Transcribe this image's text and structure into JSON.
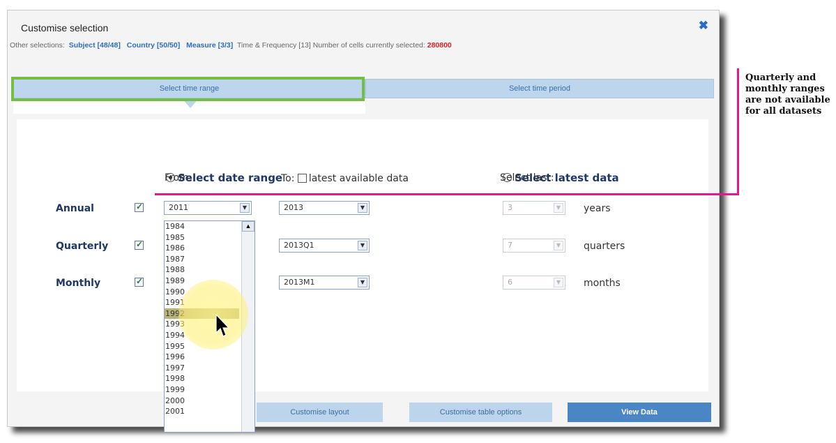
{
  "dialog": {
    "title": "Customise selection",
    "close_glyph": "✖",
    "other_label": "Other selections:",
    "subject": "Subject [48/48]",
    "country": "Country [50/50]",
    "measure": "Measure [3/3]",
    "time_freq": "Time & Frequency [13]",
    "cells_label": "Number of cells currently selected:",
    "cells_count": "280800"
  },
  "tabs": {
    "left": "Select time range",
    "right": "Select time period"
  },
  "annotation": "Quarterly and monthly ranges are not available for all datasets",
  "range": {
    "date_range": "Select date range",
    "latest_data": "Select latest data",
    "from": "From:",
    "to": "To:",
    "latest_available": "latest available data",
    "select_last": "Select last:"
  },
  "rows": [
    {
      "label": "Annual",
      "from": "2011",
      "to": "2013",
      "last": "3",
      "unit": "years"
    },
    {
      "label": "Quarterly",
      "from": "",
      "to": "2013Q1",
      "last": "7",
      "unit": "quarters"
    },
    {
      "label": "Monthly",
      "from": "",
      "to": "2013M1",
      "last": "6",
      "unit": "months"
    }
  ],
  "dropdown_years": [
    "1984",
    "1985",
    "1986",
    "1987",
    "1988",
    "1989",
    "1990",
    "1991",
    "1992",
    "1993",
    "1994",
    "1995",
    "1996",
    "1997",
    "1998",
    "1999",
    "2000",
    "2001"
  ],
  "highlighted_year": "1992",
  "buttons": {
    "layout": "Customise layout",
    "table": "Customise table options",
    "view": "View Data"
  },
  "colors": {
    "accent_green": "#72bf44",
    "accent_magenta": "#e6168c",
    "count_red": "#e02020",
    "link_blue": "#2d6fbe"
  }
}
